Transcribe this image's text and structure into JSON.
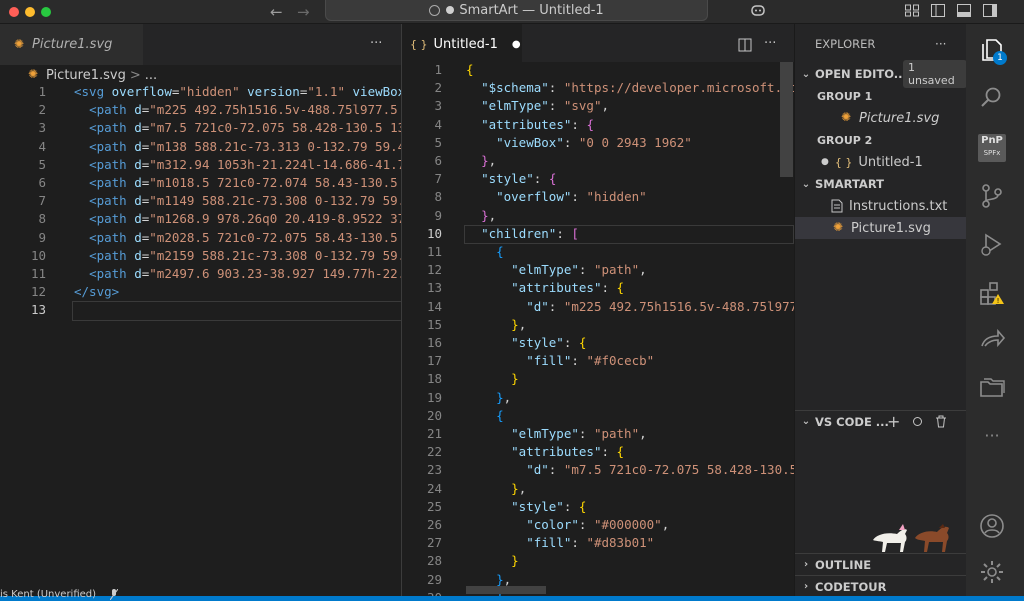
{
  "window": {
    "title": "SmartArt — Untitled-1",
    "colors": {
      "close": "#ff5f57",
      "minimize": "#febc2e",
      "maximize": "#28c840",
      "accent": "#007acc"
    }
  },
  "group1": {
    "tab_label": "Picture1.svg",
    "breadcrumb_file": "Picture1.svg",
    "breadcrumb_sep": ">",
    "breadcrumb_more": "...",
    "more": "···",
    "line_numbers": [
      "1",
      "2",
      "3",
      "4",
      "5",
      "6",
      "7",
      "8",
      "9",
      "10",
      "11",
      "12",
      "13"
    ],
    "lines": [
      [
        [
          "tag",
          "<svg "
        ],
        [
          "attr",
          "overflow"
        ],
        [
          "def",
          "="
        ],
        [
          "str",
          "\"hidden\""
        ],
        [
          "def",
          " "
        ],
        [
          "attr",
          "version"
        ],
        [
          "def",
          "="
        ],
        [
          "str",
          "\"1.1\""
        ],
        [
          "def",
          " "
        ],
        [
          "attr",
          "viewBox"
        ],
        [
          "def",
          "="
        ]
      ],
      [
        [
          "def",
          "  "
        ],
        [
          "tag",
          "<path "
        ],
        [
          "attr",
          "d"
        ],
        [
          "def",
          "="
        ],
        [
          "str",
          "\"m225 492.75h1516.5v-488.75l977.5 97"
        ]
      ],
      [
        [
          "def",
          "  "
        ],
        [
          "tag",
          "<path "
        ],
        [
          "attr",
          "d"
        ],
        [
          "def",
          "="
        ],
        [
          "str",
          "\"m7.5 721c0-72.075 58.428-130.5 130."
        ]
      ],
      [
        [
          "def",
          "  "
        ],
        [
          "tag",
          "<path "
        ],
        [
          "attr",
          "d"
        ],
        [
          "def",
          "="
        ],
        [
          "str",
          "\"m138 588.21c-73.313 0-132.79 59.482"
        ]
      ],
      [
        [
          "def",
          "  "
        ],
        [
          "tag",
          "<path "
        ],
        [
          "attr",
          "d"
        ],
        [
          "def",
          "="
        ],
        [
          "str",
          "\"m312.94 1053h-21.224l-14.686-41.743"
        ]
      ],
      [
        [
          "def",
          "  "
        ],
        [
          "tag",
          "<path "
        ],
        [
          "attr",
          "d"
        ],
        [
          "def",
          "="
        ],
        [
          "str",
          "\"m1018.5 721c0-72.074 58.43-130.5 13"
        ]
      ],
      [
        [
          "def",
          "  "
        ],
        [
          "tag",
          "<path "
        ],
        [
          "attr",
          "d"
        ],
        [
          "def",
          "="
        ],
        [
          "str",
          "\"m1149 588.21c-73.308 0-132.79 59.48"
        ]
      ],
      [
        [
          "def",
          "  "
        ],
        [
          "tag",
          "<path "
        ],
        [
          "attr",
          "d"
        ],
        [
          "def",
          "="
        ],
        [
          "str",
          "\"m1268.9 978.26q0 20.419-8.9522 37.0"
        ]
      ],
      [
        [
          "def",
          "  "
        ],
        [
          "tag",
          "<path "
        ],
        [
          "attr",
          "d"
        ],
        [
          "def",
          "="
        ],
        [
          "str",
          "\"m2028.5 721c0-72.075 58.43-130.5 13"
        ]
      ],
      [
        [
          "def",
          "  "
        ],
        [
          "tag",
          "<path "
        ],
        [
          "attr",
          "d"
        ],
        [
          "def",
          "="
        ],
        [
          "str",
          "\"m2159 588.21c-73.308 0-132.79 59.48"
        ]
      ],
      [
        [
          "def",
          "  "
        ],
        [
          "tag",
          "<path "
        ],
        [
          "attr",
          "d"
        ],
        [
          "def",
          "="
        ],
        [
          "str",
          "\"m2497.6 903.23-38.927 149.77h-22.43"
        ]
      ],
      [
        [
          "tag",
          "</svg>"
        ]
      ],
      []
    ]
  },
  "group2": {
    "tab_label": "Untitled-1",
    "tab_icon": "{ }",
    "modified_dot": "●",
    "more": "···",
    "line_numbers": [
      "1",
      "2",
      "3",
      "4",
      "5",
      "6",
      "7",
      "8",
      "9",
      "10",
      "11",
      "12",
      "13",
      "14",
      "15",
      "16",
      "17",
      "18",
      "19",
      "20",
      "21",
      "22",
      "23",
      "24",
      "25",
      "26",
      "27",
      "28",
      "29",
      "30"
    ],
    "lines": [
      [
        [
          "y",
          "{"
        ]
      ],
      [
        [
          "def",
          "  "
        ],
        [
          "key",
          "\"$schema\""
        ],
        [
          "def",
          ": "
        ],
        [
          "jstr",
          "\"https://developer.microsoft.com"
        ]
      ],
      [
        [
          "def",
          "  "
        ],
        [
          "key",
          "\"elmType\""
        ],
        [
          "def",
          ": "
        ],
        [
          "jstr",
          "\"svg\""
        ],
        [
          "def",
          ","
        ]
      ],
      [
        [
          "def",
          "  "
        ],
        [
          "key",
          "\"attributes\""
        ],
        [
          "def",
          ": "
        ],
        [
          "p",
          "{"
        ]
      ],
      [
        [
          "def",
          "    "
        ],
        [
          "key",
          "\"viewBox\""
        ],
        [
          "def",
          ": "
        ],
        [
          "jstr",
          "\"0 0 2943 1962\""
        ]
      ],
      [
        [
          "def",
          "  "
        ],
        [
          "p",
          "}"
        ],
        [
          "def",
          ","
        ]
      ],
      [
        [
          "def",
          "  "
        ],
        [
          "key",
          "\"style\""
        ],
        [
          "def",
          ": "
        ],
        [
          "p",
          "{"
        ]
      ],
      [
        [
          "def",
          "    "
        ],
        [
          "key",
          "\"overflow\""
        ],
        [
          "def",
          ": "
        ],
        [
          "jstr",
          "\"hidden\""
        ]
      ],
      [
        [
          "def",
          "  "
        ],
        [
          "p",
          "}"
        ],
        [
          "def",
          ","
        ]
      ],
      [
        [
          "def",
          "  "
        ],
        [
          "key",
          "\"children\""
        ],
        [
          "def",
          ": "
        ],
        [
          "p",
          "["
        ]
      ],
      [
        [
          "def",
          "    "
        ],
        [
          "b",
          "{"
        ]
      ],
      [
        [
          "def",
          "      "
        ],
        [
          "key",
          "\"elmType\""
        ],
        [
          "def",
          ": "
        ],
        [
          "jstr",
          "\"path\""
        ],
        [
          "def",
          ","
        ]
      ],
      [
        [
          "def",
          "      "
        ],
        [
          "key",
          "\"attributes\""
        ],
        [
          "def",
          ": "
        ],
        [
          "y",
          "{"
        ]
      ],
      [
        [
          "def",
          "        "
        ],
        [
          "key",
          "\"d\""
        ],
        [
          "def",
          ": "
        ],
        [
          "jstr",
          "\"m225 492.75h1516.5v-488.75l977."
        ]
      ],
      [
        [
          "def",
          "      "
        ],
        [
          "y",
          "}"
        ],
        [
          "def",
          ","
        ]
      ],
      [
        [
          "def",
          "      "
        ],
        [
          "key",
          "\"style\""
        ],
        [
          "def",
          ": "
        ],
        [
          "y",
          "{"
        ]
      ],
      [
        [
          "def",
          "        "
        ],
        [
          "key",
          "\"fill\""
        ],
        [
          "def",
          ": "
        ],
        [
          "jstr",
          "\"#f0cecb\""
        ]
      ],
      [
        [
          "def",
          "      "
        ],
        [
          "y",
          "}"
        ]
      ],
      [
        [
          "def",
          "    "
        ],
        [
          "b",
          "}"
        ],
        [
          "def",
          ","
        ]
      ],
      [
        [
          "def",
          "    "
        ],
        [
          "b",
          "{"
        ]
      ],
      [
        [
          "def",
          "      "
        ],
        [
          "key",
          "\"elmType\""
        ],
        [
          "def",
          ": "
        ],
        [
          "jstr",
          "\"path\""
        ],
        [
          "def",
          ","
        ]
      ],
      [
        [
          "def",
          "      "
        ],
        [
          "key",
          "\"attributes\""
        ],
        [
          "def",
          ": "
        ],
        [
          "y",
          "{"
        ]
      ],
      [
        [
          "def",
          "        "
        ],
        [
          "key",
          "\"d\""
        ],
        [
          "def",
          ": "
        ],
        [
          "jstr",
          "\"m7.5 721c0-72.075 58.428-130.5"
        ]
      ],
      [
        [
          "def",
          "      "
        ],
        [
          "y",
          "}"
        ],
        [
          "def",
          ","
        ]
      ],
      [
        [
          "def",
          "      "
        ],
        [
          "key",
          "\"style\""
        ],
        [
          "def",
          ": "
        ],
        [
          "y",
          "{"
        ]
      ],
      [
        [
          "def",
          "        "
        ],
        [
          "key",
          "\"color\""
        ],
        [
          "def",
          ": "
        ],
        [
          "jstr",
          "\"#000000\""
        ],
        [
          "def",
          ","
        ]
      ],
      [
        [
          "def",
          "        "
        ],
        [
          "key",
          "\"fill\""
        ],
        [
          "def",
          ": "
        ],
        [
          "jstr",
          "\"#d83b01\""
        ]
      ],
      [
        [
          "def",
          "      "
        ],
        [
          "y",
          "}"
        ]
      ],
      [
        [
          "def",
          "    "
        ],
        [
          "b",
          "}"
        ],
        [
          "def",
          ","
        ]
      ],
      [
        [
          "def",
          "    "
        ],
        [
          "b",
          "{"
        ]
      ]
    ]
  },
  "explorer": {
    "title": "EXPLORER",
    "more": "···",
    "open_editors": "OPEN EDITO...",
    "unsaved_badge": "1 unsaved",
    "group1_label": "GROUP 1",
    "group1_file": "Picture1.svg",
    "group2_label": "GROUP 2",
    "group2_dot": "●",
    "group2_icon": "{ }",
    "group2_file": "Untitled-1",
    "folder_name": "SMARTART",
    "files": [
      "Instructions.txt",
      "Picture1.svg"
    ],
    "vscode_section": "VS CODE ...",
    "outline": "OUTLINE",
    "codetour": "CODETOUR"
  },
  "activity": {
    "badge": "1",
    "pnp_top": "PnP",
    "pnp_bottom": "SPFx",
    "more": "···"
  },
  "status": {
    "author": "is Kent (Unverified)"
  }
}
